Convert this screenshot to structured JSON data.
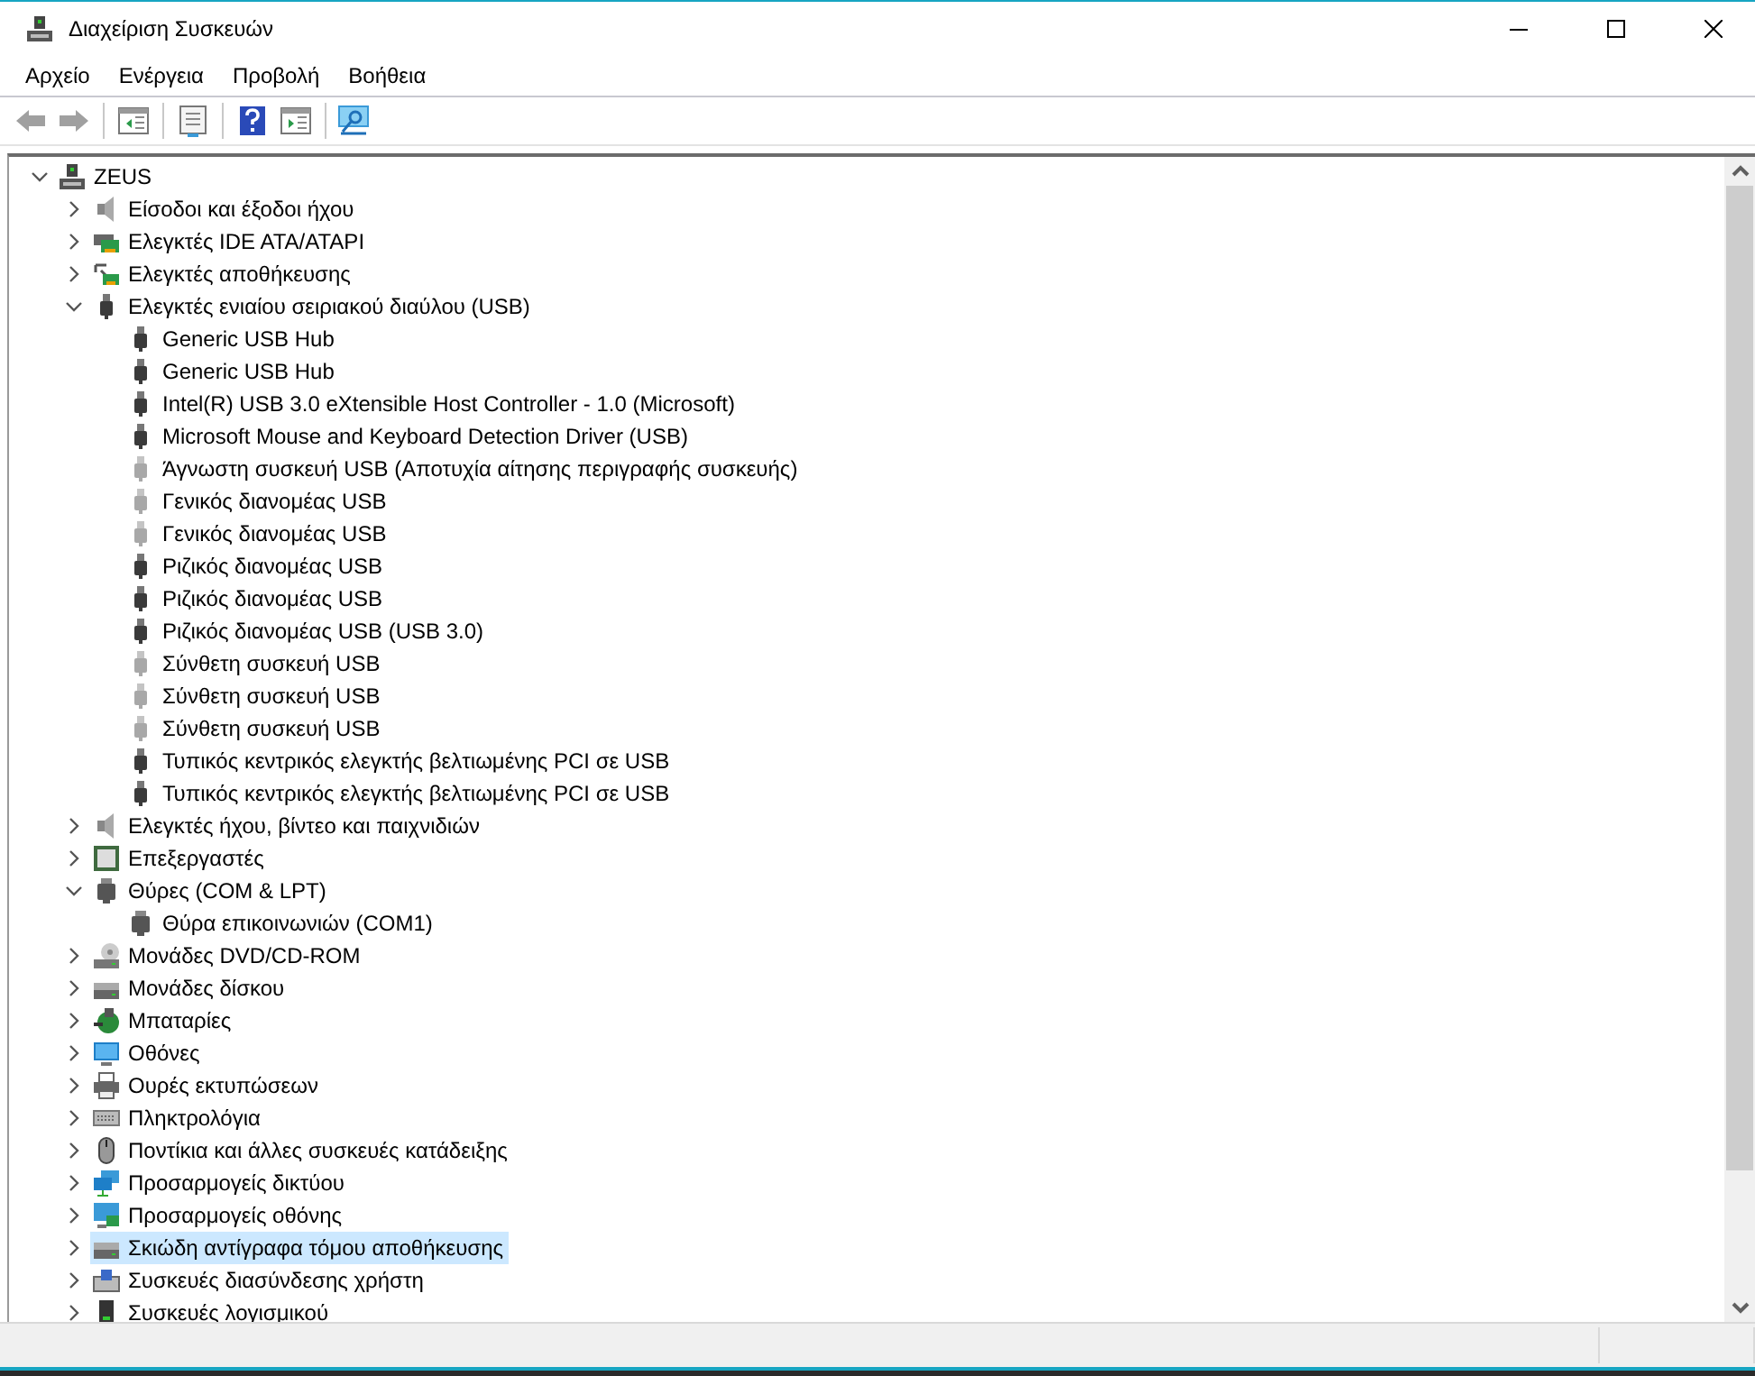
{
  "window": {
    "title": "Διαχείριση Συσκευών"
  },
  "menu": [
    "Αρχείο",
    "Ενέργεια",
    "Προβολή",
    "Βοήθεια"
  ],
  "toolbar": [
    {
      "kind": "back",
      "disabled": true
    },
    {
      "kind": "forward",
      "disabled": true
    },
    {
      "kind": "sep"
    },
    {
      "kind": "pane"
    },
    {
      "kind": "sep"
    },
    {
      "kind": "props"
    },
    {
      "kind": "sep"
    },
    {
      "kind": "help"
    },
    {
      "kind": "pane2"
    },
    {
      "kind": "sep"
    },
    {
      "kind": "scan"
    }
  ],
  "tree": [
    {
      "label": "ZEUS",
      "kind": "computer",
      "expanded": true,
      "selected": false,
      "children": [
        {
          "label": "Είσοδοι και έξοδοι ήχου",
          "kind": "audio",
          "expanded": false,
          "selected": false
        },
        {
          "label": "Ελεγκτές IDE ATA/ATAPI",
          "kind": "ide",
          "expanded": false,
          "selected": false
        },
        {
          "label": "Ελεγκτές αποθήκευσης",
          "kind": "storage",
          "expanded": false,
          "selected": false
        },
        {
          "label": "Ελεγκτές ενιαίου σειριακού διαύλου (USB)",
          "kind": "usb",
          "expanded": true,
          "selected": false,
          "children": [
            {
              "label": "Generic USB Hub",
              "kind": "usb",
              "selected": false
            },
            {
              "label": "Generic USB Hub",
              "kind": "usb",
              "selected": false
            },
            {
              "label": "Intel(R) USB 3.0 eXtensible Host Controller - 1.0 (Microsoft)",
              "kind": "usb",
              "selected": false
            },
            {
              "label": "Microsoft Mouse and Keyboard Detection Driver (USB)",
              "kind": "usb",
              "selected": false
            },
            {
              "label": "Άγνωστη συσκευή USB (Αποτυχία αίτησης περιγραφής συσκευής)",
              "kind": "usb-faded",
              "selected": false
            },
            {
              "label": "Γενικός διανομέας USB",
              "kind": "usb-faded",
              "selected": false
            },
            {
              "label": "Γενικός διανομέας USB",
              "kind": "usb-faded",
              "selected": false
            },
            {
              "label": "Ριζικός διανομέας USB",
              "kind": "usb",
              "selected": false
            },
            {
              "label": "Ριζικός διανομέας USB",
              "kind": "usb",
              "selected": false
            },
            {
              "label": "Ριζικός διανομέας USB (USB 3.0)",
              "kind": "usb",
              "selected": false
            },
            {
              "label": "Σύνθετη συσκευή USB",
              "kind": "usb-faded",
              "selected": false
            },
            {
              "label": "Σύνθετη συσκευή USB",
              "kind": "usb-faded",
              "selected": false
            },
            {
              "label": "Σύνθετη συσκευή USB",
              "kind": "usb-faded",
              "selected": false
            },
            {
              "label": "Τυπικός κεντρικός ελεγκτής βελτιωμένης PCI σε USB",
              "kind": "usb",
              "selected": false
            },
            {
              "label": "Τυπικός κεντρικός ελεγκτής βελτιωμένης PCI σε USB",
              "kind": "usb",
              "selected": false
            }
          ]
        },
        {
          "label": "Ελεγκτές ήχου, βίντεο και παιχνιδιών",
          "kind": "audio",
          "expanded": false,
          "selected": false
        },
        {
          "label": "Επεξεργαστές",
          "kind": "cpu",
          "expanded": false,
          "selected": false
        },
        {
          "label": "Θύρες (COM & LPT)",
          "kind": "port",
          "expanded": true,
          "selected": false,
          "children": [
            {
              "label": "Θύρα επικοινωνιών (COM1)",
              "kind": "port",
              "selected": false
            }
          ]
        },
        {
          "label": "Μονάδες DVD/CD-ROM",
          "kind": "dvd",
          "expanded": false,
          "selected": false
        },
        {
          "label": "Μονάδες δίσκου",
          "kind": "disk",
          "expanded": false,
          "selected": false
        },
        {
          "label": "Μπαταρίες",
          "kind": "battery",
          "expanded": false,
          "selected": false
        },
        {
          "label": "Οθόνες",
          "kind": "monitor",
          "expanded": false,
          "selected": false
        },
        {
          "label": "Ουρές εκτυπώσεων",
          "kind": "printer",
          "expanded": false,
          "selected": false
        },
        {
          "label": "Πληκτρολόγια",
          "kind": "keyboard",
          "expanded": false,
          "selected": false
        },
        {
          "label": "Ποντίκια και άλλες συσκευές κατάδειξης",
          "kind": "mouse",
          "expanded": false,
          "selected": false
        },
        {
          "label": "Προσαρμογείς δικτύου",
          "kind": "network",
          "expanded": false,
          "selected": false
        },
        {
          "label": "Προσαρμογείς οθόνης",
          "kind": "display",
          "expanded": false,
          "selected": false
        },
        {
          "label": "Σκιώδη αντίγραφα τόμου αποθήκευσης",
          "kind": "disk",
          "expanded": false,
          "selected": true
        },
        {
          "label": "Συσκευές διασύνδεσης χρήστη",
          "kind": "hid",
          "expanded": false,
          "selected": false
        },
        {
          "label": "Συσκευές λογισμικού",
          "kind": "software",
          "expanded": false,
          "selected": false
        }
      ]
    }
  ]
}
